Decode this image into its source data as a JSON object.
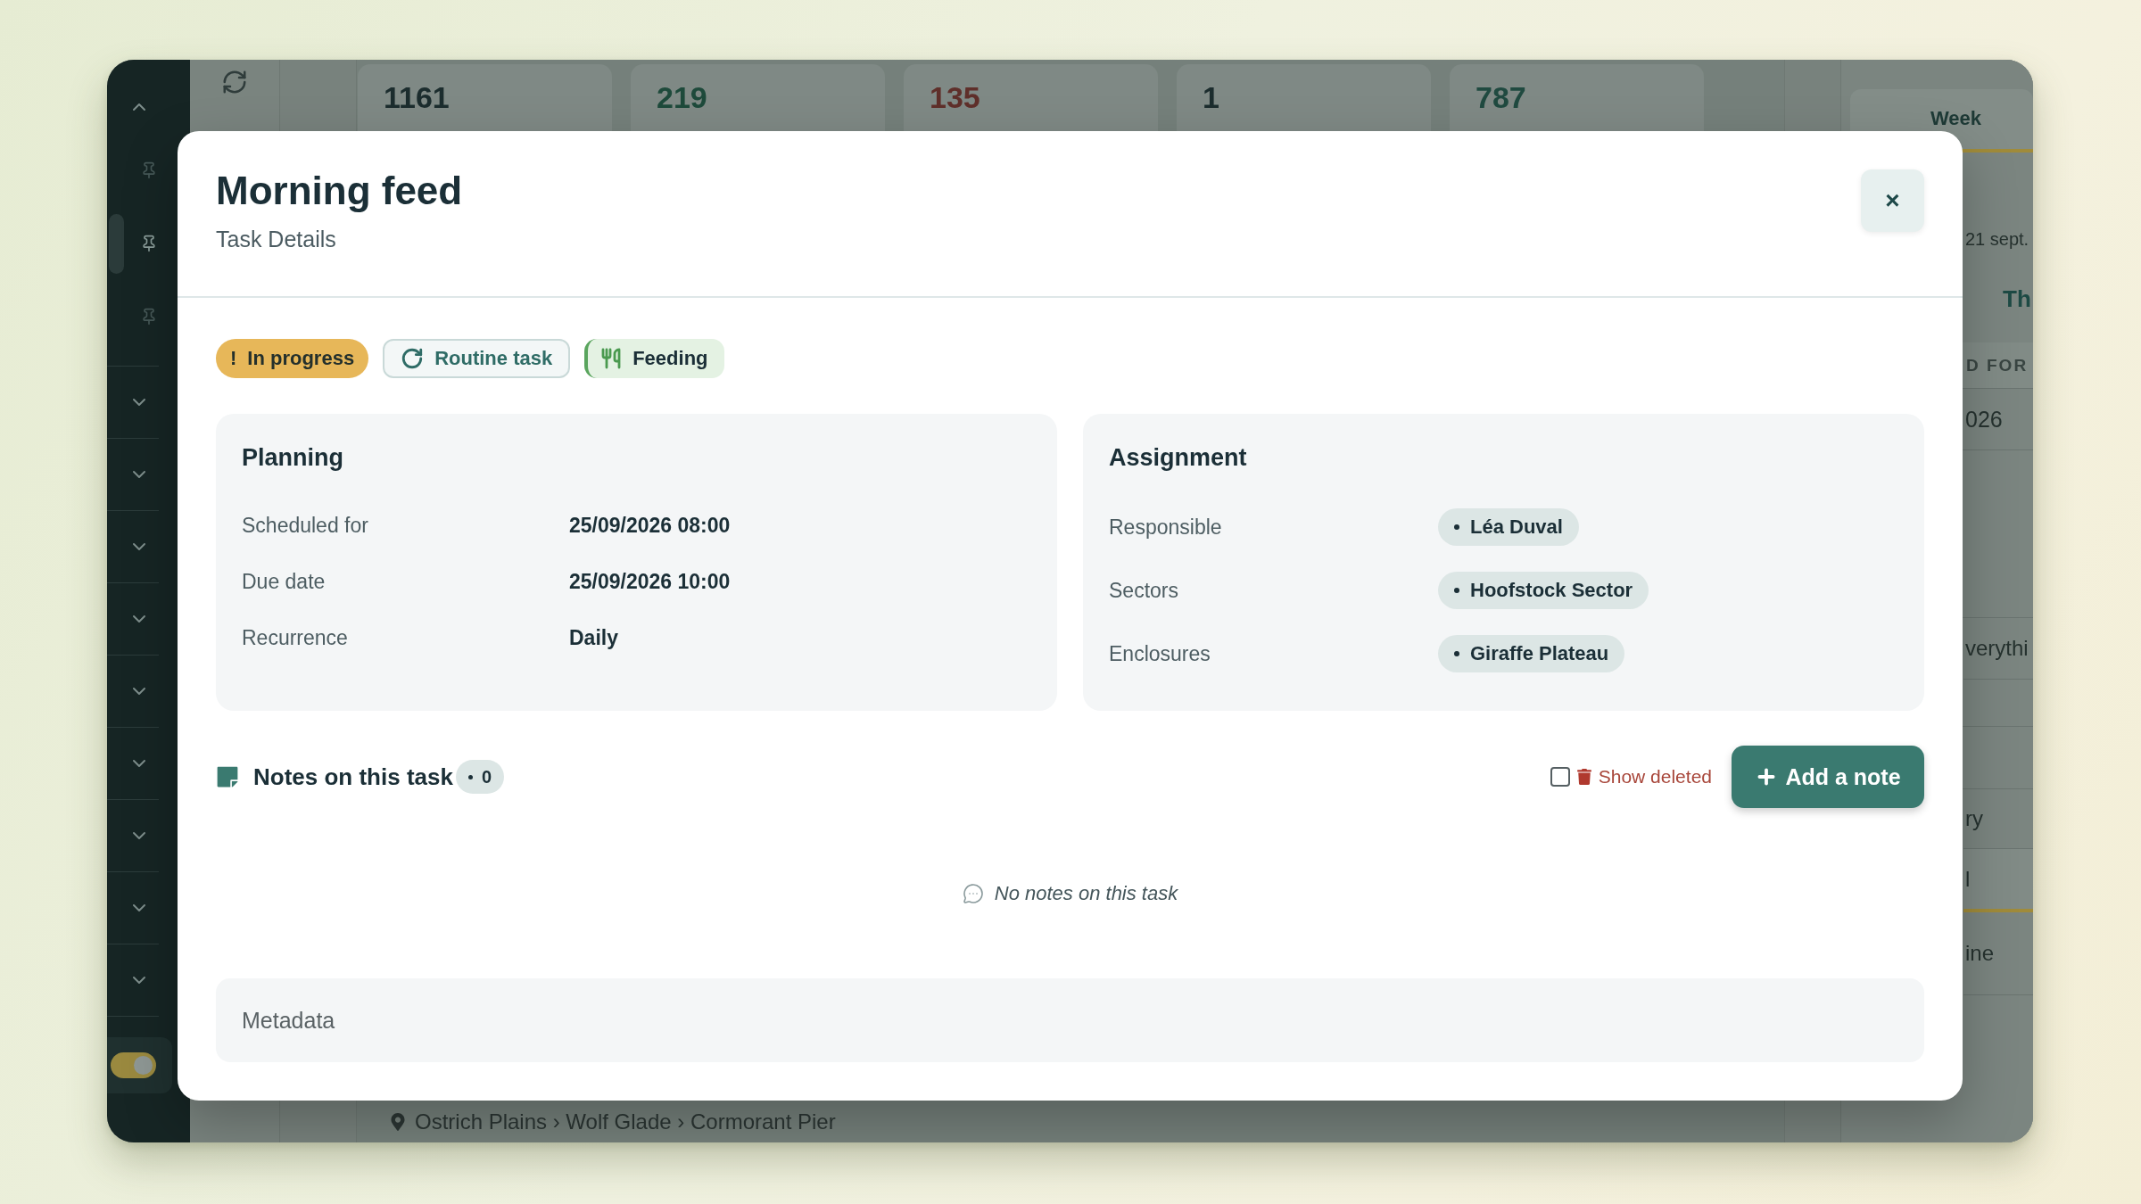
{
  "sidebar": {
    "group": {
      "expanded": true
    },
    "pins": [
      {
        "selected": false
      },
      {
        "selected": true
      },
      {
        "selected": false
      }
    ],
    "sections": [
      {
        "expanded": false
      },
      {
        "expanded": false
      },
      {
        "expanded": false
      },
      {
        "expanded": false
      },
      {
        "expanded": false
      },
      {
        "expanded": false
      },
      {
        "expanded": false
      },
      {
        "expanded": false
      },
      {
        "expanded": false
      }
    ],
    "toggle": {
      "on": true
    }
  },
  "stats": [
    {
      "value": "1161",
      "color": "#1c2d2e"
    },
    {
      "value": "219",
      "color": "#1e4a3b"
    },
    {
      "value": "135",
      "color": "#5f2f2a"
    },
    {
      "value": "1",
      "color": "#1c2d2e"
    },
    {
      "value": "787",
      "color": "#204a40"
    }
  ],
  "breadcrumb": "Ostrich Plains › Wolf Glade › Cormorant Pier",
  "side_panel": {
    "tab": {
      "label": "Week",
      "selected": true
    },
    "date_range": "21 sept.",
    "heading": "Th",
    "table": {
      "column_header": "D FOR",
      "cell": "026"
    },
    "quick_filters": [
      {
        "label": "verythi",
        "selected": false
      }
    ],
    "status_filters": [
      {
        "label": "ry",
        "selected": false
      },
      {
        "label": "l",
        "selected": true
      },
      {
        "label": "ine",
        "selected": false
      }
    ]
  },
  "dialog": {
    "title": "Morning feed",
    "subtitle": "Task Details",
    "close_label": "×",
    "badges": [
      {
        "kind": "status",
        "mark": "!",
        "label": "In progress"
      },
      {
        "kind": "routine",
        "label": "Routine task"
      },
      {
        "kind": "category",
        "label": "Feeding"
      }
    ],
    "planning": {
      "title": "Planning",
      "rows": [
        {
          "label": "Scheduled for",
          "value": "25/09/2026 08:00"
        },
        {
          "label": "Due date",
          "value": "25/09/2026 10:00"
        },
        {
          "label": "Recurrence",
          "value": "Daily"
        }
      ]
    },
    "assignment": {
      "title": "Assignment",
      "rows": [
        {
          "label": "Responsible",
          "chips": [
            "Léa Duval"
          ]
        },
        {
          "label": "Sectors",
          "chips": [
            "Hoofstock Sector"
          ]
        },
        {
          "label": "Enclosures",
          "chips": [
            "Giraffe Plateau"
          ]
        }
      ]
    },
    "notes": {
      "title": "Notes on this task",
      "count": "0",
      "show_deleted": {
        "label": "Show deleted",
        "checked": false
      },
      "add_label": "Add a note",
      "empty_message": "No notes on this task"
    },
    "metadata": {
      "label": "Metadata"
    }
  }
}
